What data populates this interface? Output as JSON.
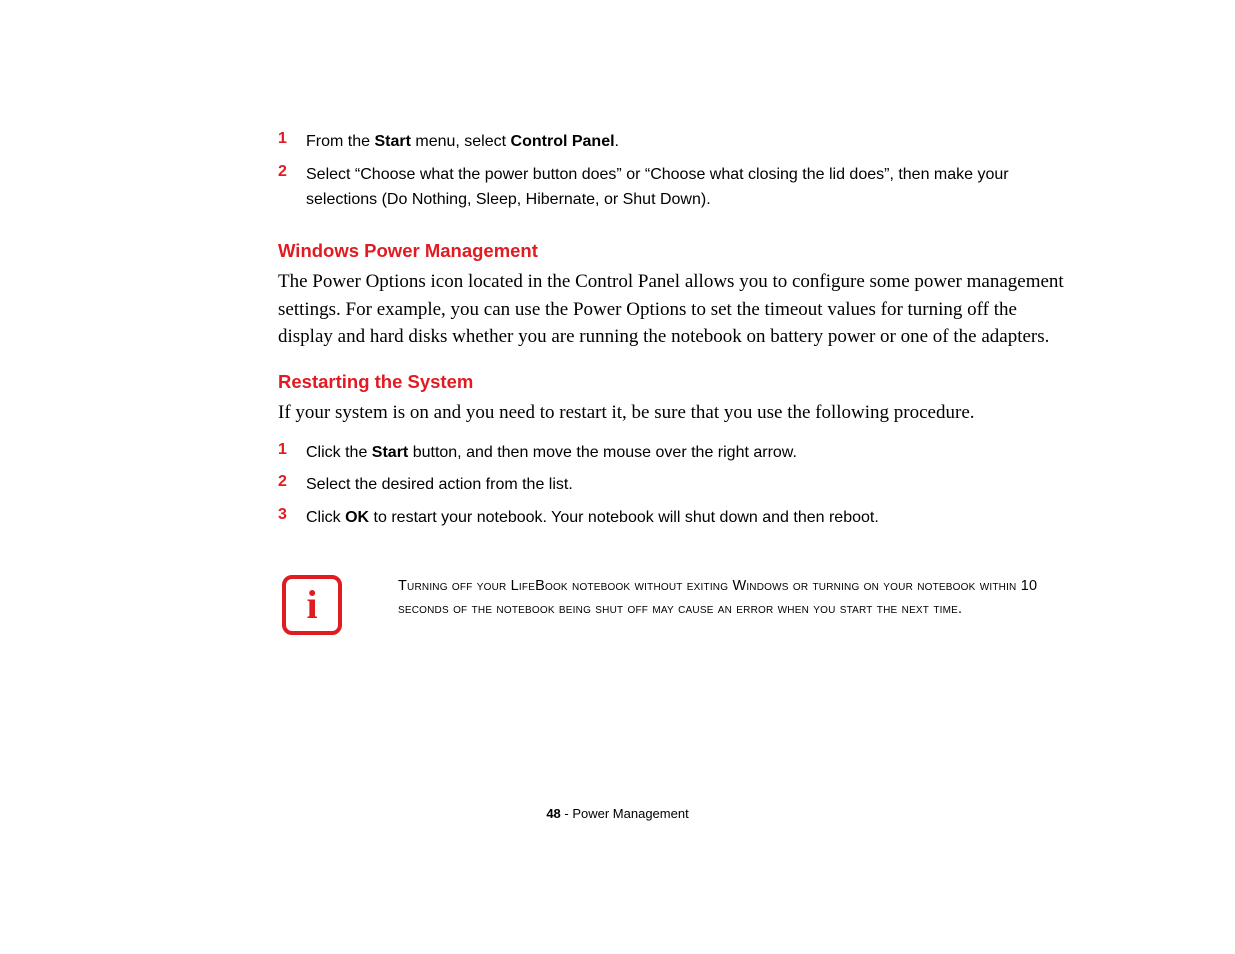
{
  "list1": {
    "items": [
      {
        "num": "1",
        "parts": [
          {
            "t": "From the ",
            "b": false
          },
          {
            "t": "Start",
            "b": true
          },
          {
            "t": " menu, select ",
            "b": false
          },
          {
            "t": "Control Panel",
            "b": true
          },
          {
            "t": ".",
            "b": false
          }
        ]
      },
      {
        "num": "2",
        "parts": [
          {
            "t": "Select “Choose what the power button does” or “Choose what closing the lid does”, then make your selections (Do Nothing, Sleep, Hibernate, or Shut Down).",
            "b": false
          }
        ]
      }
    ]
  },
  "section1": {
    "heading": "Windows Power Management",
    "body": "The Power Options icon located in the Control Panel allows you to configure some power management settings. For example, you can use the Power Options to set the timeout values for turning off the display and hard disks whether you are running the notebook on battery power or one of the adapters."
  },
  "section2": {
    "heading": "Restarting the System",
    "body": "If your system is on and you need to restart it, be sure that you use the following procedure."
  },
  "list2": {
    "items": [
      {
        "num": "1",
        "parts": [
          {
            "t": "Click the ",
            "b": false
          },
          {
            "t": "Start",
            "b": true
          },
          {
            "t": " button, and then move the mouse over the right arrow.",
            "b": false
          }
        ]
      },
      {
        "num": "2",
        "parts": [
          {
            "t": "Select the desired action from the list.",
            "b": false
          }
        ]
      },
      {
        "num": "3",
        "parts": [
          {
            "t": "Click ",
            "b": false
          },
          {
            "t": "OK",
            "b": true
          },
          {
            "t": " to restart your notebook. Your notebook will shut down and then reboot.",
            "b": false
          }
        ]
      }
    ]
  },
  "info": {
    "icon_letter": "i",
    "text": "Turning off your LifeBook notebook without exiting Windows or turning on your notebook within 10 seconds of the notebook being shut off may cause an error when you start the next time."
  },
  "footer": {
    "page_number": "48",
    "sep": " - ",
    "title": "Power Management"
  }
}
